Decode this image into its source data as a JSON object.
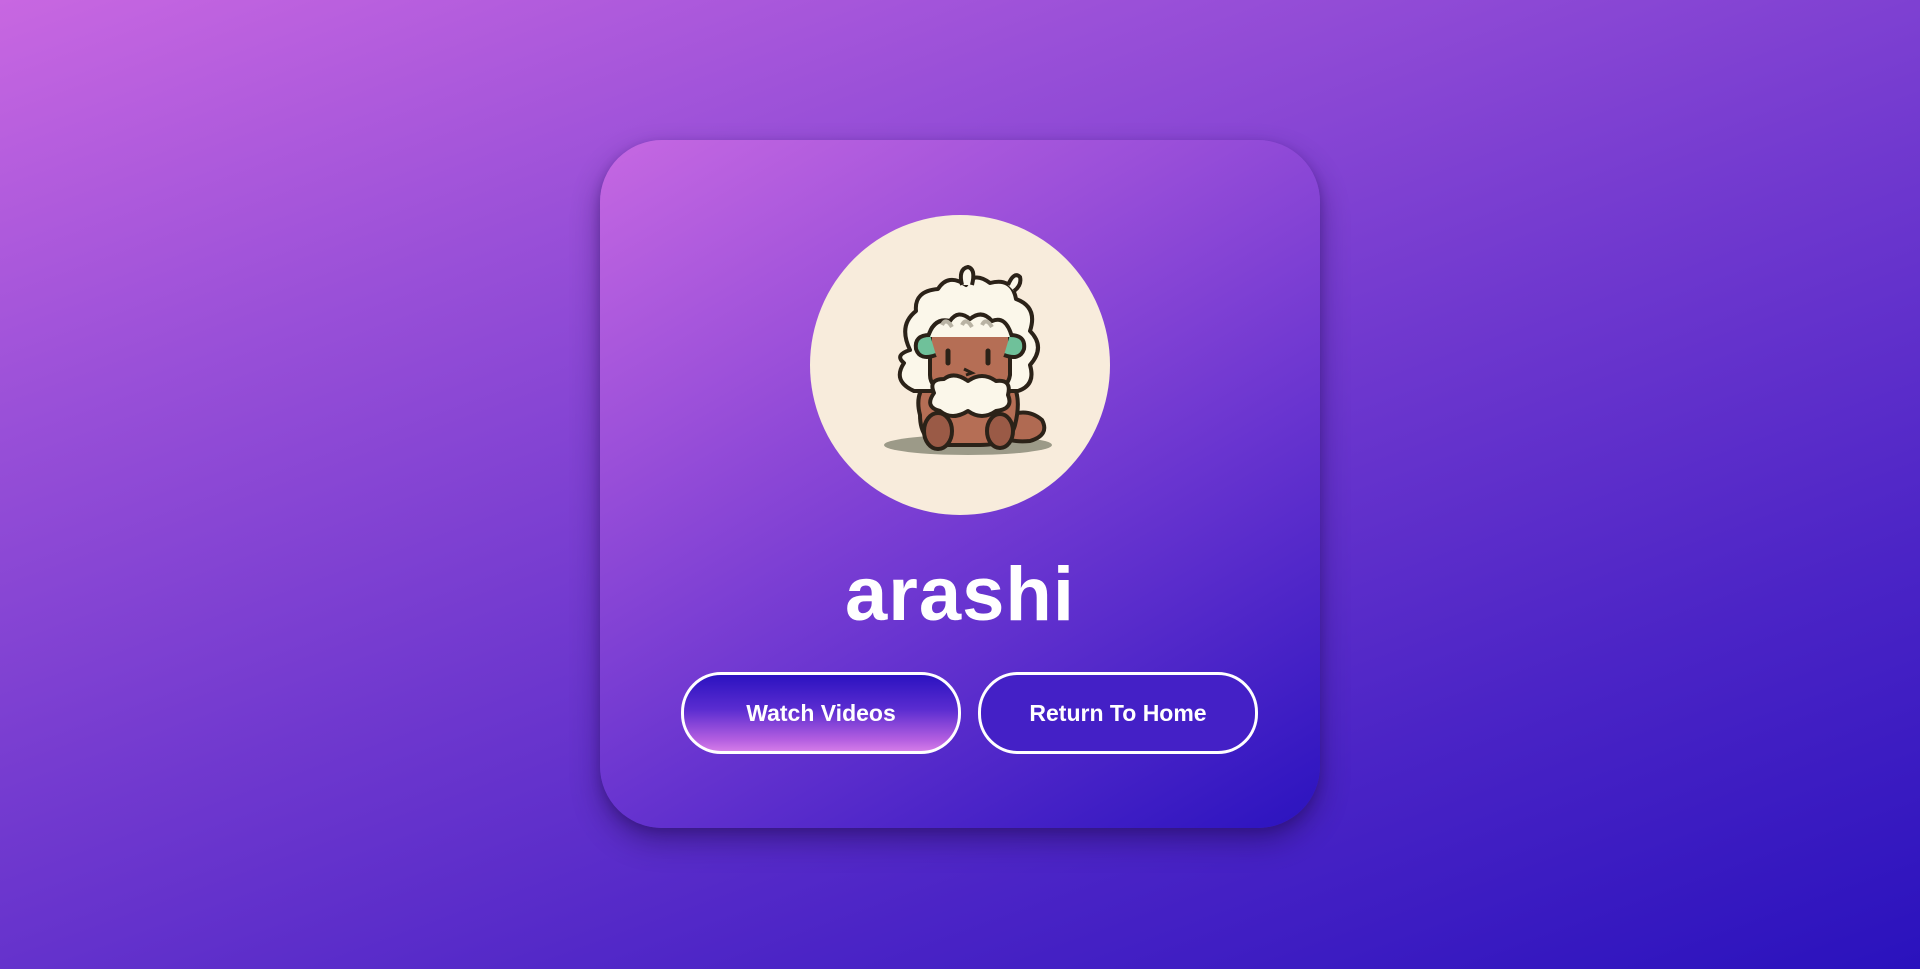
{
  "profile": {
    "name": "arashi",
    "avatar_icon": "sheep-plush-avatar"
  },
  "actions": {
    "watch_label": "Watch Videos",
    "home_label": "Return To Home"
  },
  "colors": {
    "background_start": "#c867e1",
    "background_end": "#2a12bd",
    "avatar_bg": "#f8ecdc",
    "text": "#ffffff"
  }
}
